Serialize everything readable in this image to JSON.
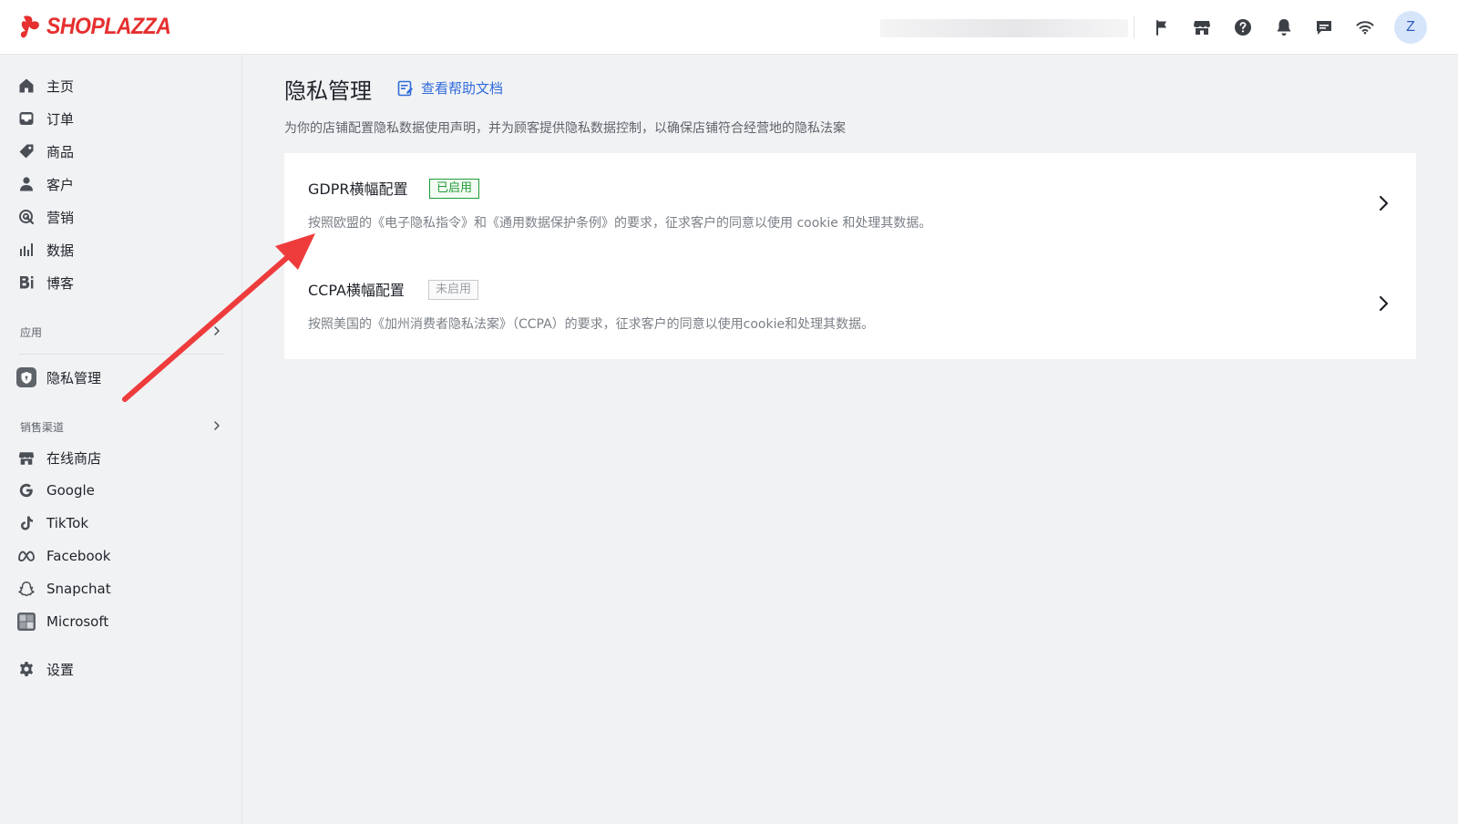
{
  "brand": {
    "name": "SHOPLAZZA",
    "color": "#e62f2f"
  },
  "header": {
    "icons": [
      "flag-icon",
      "store-icon",
      "help-circle-icon",
      "bell-icon",
      "chat-icon",
      "wifi-icon"
    ],
    "avatar_initial": "Z"
  },
  "sidebar": {
    "main_items": [
      {
        "label": "主页",
        "icon": "home-icon"
      },
      {
        "label": "订单",
        "icon": "inbox-icon"
      },
      {
        "label": "商品",
        "icon": "tag-icon"
      },
      {
        "label": "客户",
        "icon": "person-icon"
      },
      {
        "label": "营销",
        "icon": "marketing-icon"
      },
      {
        "label": "数据",
        "icon": "bar-chart-icon"
      },
      {
        "label": "博客",
        "icon": "blog-icon"
      }
    ],
    "apps_section": "应用",
    "privacy_item": {
      "label": "隐私管理",
      "icon": "shield-icon"
    },
    "sales_section": "销售渠道",
    "channels": [
      {
        "label": "在线商店",
        "icon": "storefront-icon"
      },
      {
        "label": "Google",
        "icon": "google-icon"
      },
      {
        "label": "TikTok",
        "icon": "tiktok-icon"
      },
      {
        "label": "Facebook",
        "icon": "meta-icon"
      },
      {
        "label": "Snapchat",
        "icon": "snapchat-icon"
      },
      {
        "label": "Microsoft",
        "icon": "microsoft-icon"
      }
    ],
    "settings": {
      "label": "设置",
      "icon": "gear-icon"
    }
  },
  "main": {
    "title": "隐私管理",
    "help_link": "查看帮助文档",
    "description": "为你的店铺配置隐私数据使用声明，并为顾客提供隐私数据控制，以确保店铺符合经营地的隐私法案",
    "banners": [
      {
        "title": "GDPR横幅配置",
        "status": "已启用",
        "status_state": "enabled",
        "description": "按照欧盟的《电子隐私指令》和《通用数据保护条例》的要求，征求客户的同意以使用 cookie 和处理其数据。"
      },
      {
        "title": "CCPA横幅配置",
        "status": "未启用",
        "status_state": "disabled",
        "description": "按照美国的《加州消费者隐私法案》（CCPA）的要求，征求客户的同意以使用cookie和处理其数据。"
      }
    ]
  },
  "colors": {
    "accent_link": "#2f6bdb",
    "enabled_green": "#1f9d37",
    "annotation_red": "#ee3c3c"
  }
}
